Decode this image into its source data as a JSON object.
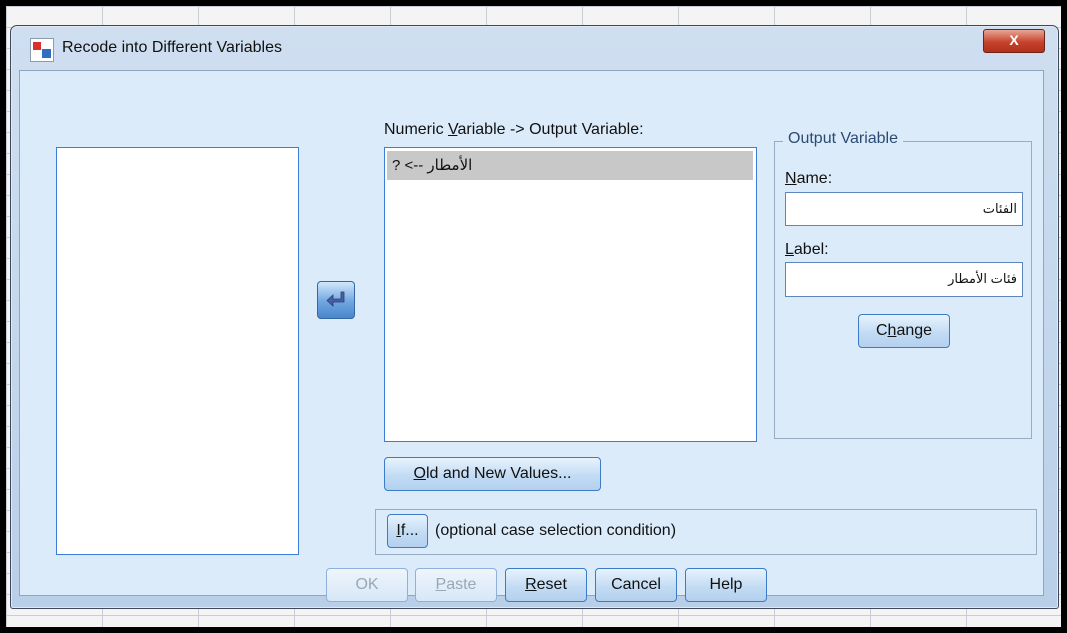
{
  "window": {
    "title": "Recode into Different Variables",
    "close_label": "X"
  },
  "source_list": {
    "items": []
  },
  "mapping_list": {
    "label_pre": "Numeric ",
    "label_mnemonic": "V",
    "label_post": "ariable -> Output Variable:",
    "items": [
      {
        "text": "الأمطار --> ?"
      }
    ]
  },
  "output_variable": {
    "group_title": "Output Variable",
    "name_label_mnemonic": "N",
    "name_label_rest": "ame:",
    "name_value": "الفئات",
    "label_label_mnemonic": "L",
    "label_label_rest": "abel:",
    "label_value": "فئات الأمطار",
    "change_pre": "C",
    "change_mnemonic": "h",
    "change_post": "ange"
  },
  "old_new_button": {
    "mnemonic": "O",
    "rest": "ld and New Values..."
  },
  "if_section": {
    "button_mnemonic": "I",
    "button_rest": "f...",
    "caption": "(optional case selection condition)"
  },
  "footer_buttons": {
    "ok": "OK",
    "paste_mnemonic": "P",
    "paste_rest": "aste",
    "reset_mnemonic": "R",
    "reset_rest": "eset",
    "cancel": "Cancel",
    "help": "Help"
  },
  "colors": {
    "accent": "#3c7bc7",
    "selection": "#c8c8c8",
    "close_button": "#c6432c"
  }
}
